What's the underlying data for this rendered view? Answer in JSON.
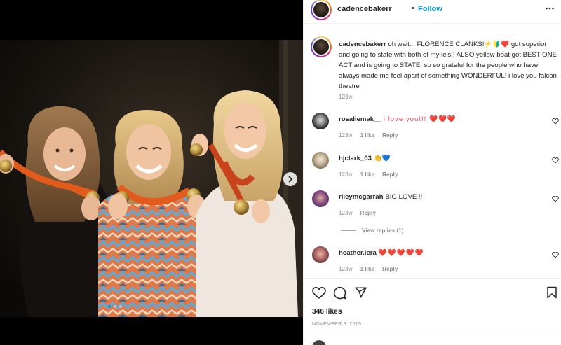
{
  "post": {
    "username": "cadencebakerr",
    "separator": "•",
    "follow_label": "Follow",
    "caption": "oh wait... FLORENCE CLANKS!⚡️🔰❤️ got superior and going to state with both of my ie's!! ALSO yellow boat got BEST ONE ACT and is going to STATE! so so grateful for the people who have always made me feel apart of something WONDERFUL! i love you falcon theatre",
    "caption_time": "123w",
    "likes": "346 likes",
    "date": "NOVEMBER 3, 2019"
  },
  "comments": [
    {
      "username": "rosaliemak__",
      "text": "i love you!!! ❤️❤️❤️",
      "time": "123w",
      "likes": "1 like",
      "reply": "Reply"
    },
    {
      "username": "hjclark_03",
      "text": "👏💙",
      "time": "123w",
      "likes": "1 like",
      "reply": "Reply"
    },
    {
      "username": "rileymcgarrah",
      "text": "BIG LOVE !!",
      "time": "123w",
      "likes": "",
      "reply": "Reply"
    },
    {
      "username": "heather.lera",
      "text": "❤️❤️❤️❤️❤️",
      "time": "123w",
      "likes": "1 like",
      "reply": "Reply"
    }
  ],
  "view_replies_label": "View replies (1)",
  "colors": {
    "accent": "#0095f6",
    "heart": "#ed4956",
    "muted": "#8e8e8e"
  },
  "icons": [
    "more-icon",
    "next-arrow-icon",
    "heart-icon",
    "comment-icon",
    "share-icon",
    "bookmark-icon"
  ]
}
